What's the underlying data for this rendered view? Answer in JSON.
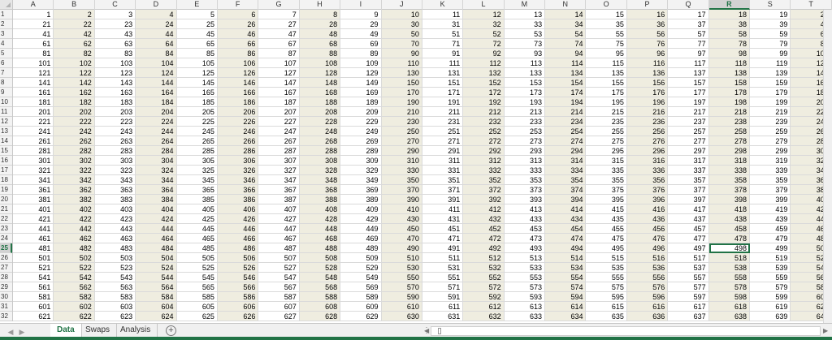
{
  "sheet": {
    "columns": [
      "A",
      "B",
      "C",
      "D",
      "E",
      "F",
      "G",
      "H",
      "I",
      "J",
      "K",
      "L",
      "M",
      "N",
      "O",
      "P",
      "Q",
      "R",
      "S",
      "T"
    ],
    "row_count": 32,
    "columns_per_row": 20,
    "selected_column": "R",
    "selected_row": 25,
    "active_cell": "R25",
    "colors": {
      "shaded_cell": "#efede0",
      "accent": "#217346"
    }
  },
  "tabs": [
    {
      "label": "Data",
      "active": true
    },
    {
      "label": "Swaps",
      "active": false
    },
    {
      "label": "Analysis",
      "active": false
    }
  ],
  "controls": {
    "add_sheet_label": "+",
    "nav_prev_label": "◀",
    "nav_next_label": "▶",
    "scroll_left_label": "◀",
    "scroll_right_label": "▶",
    "splitter_label": "⋮"
  }
}
